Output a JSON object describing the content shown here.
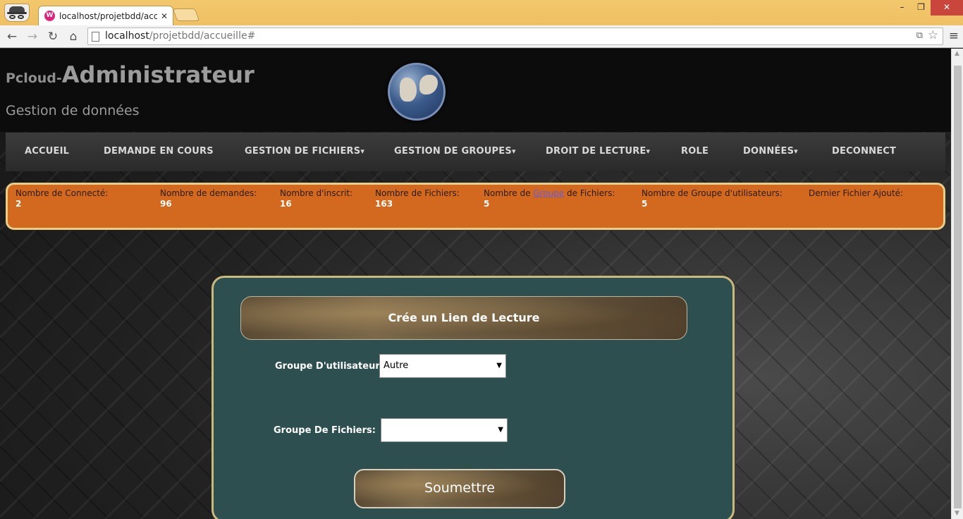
{
  "browser": {
    "tab_title": "localhost/projetbdd/accu",
    "favicon_text": "W",
    "url_host": "localhost",
    "url_path": "/projetbdd/accueille#",
    "window_controls": {
      "minimize": "–",
      "maximize": "❐",
      "close": "✕"
    }
  },
  "header": {
    "brand_small": "Pcloud-",
    "brand_big": "Administrateur",
    "subtitle": "Gestion de données"
  },
  "nav": {
    "items": [
      {
        "label": "ACCUEIL",
        "dropdown": false
      },
      {
        "label": "DEMANDE EN COURS",
        "dropdown": false
      },
      {
        "label": "GESTION DE FICHIERS",
        "dropdown": true
      },
      {
        "label": "GESTION DE GROUPES",
        "dropdown": true
      },
      {
        "label": "DROIT DE LECTURE",
        "dropdown": true
      },
      {
        "label": "ROLE",
        "dropdown": false
      },
      {
        "label": "DONNÉES",
        "dropdown": true
      },
      {
        "label": "DECONNECT",
        "dropdown": false
      }
    ],
    "caret": "▾"
  },
  "stats": {
    "connected_label": "Nombre de Connecté:",
    "connected_value": "2",
    "requests_label": "Nombre de demandes:",
    "requests_value": "96",
    "registered_label": "Nombre d'inscrit:",
    "registered_value": "16",
    "files_label": "Nombre de Fichiers:",
    "files_value": "163",
    "file_groups_label_pre": "Nombre de ",
    "file_groups_label_link": "Groupe",
    "file_groups_label_post": " de Fichiers:",
    "file_groups_value": "5",
    "user_groups_label": "Nombre de Groupe d'utilisateurs:",
    "user_groups_value": "5",
    "last_file_label": "Dernier Fichier Ajouté:",
    "last_file_value": ""
  },
  "form": {
    "title": "Crée un Lien de Lecture",
    "user_group_label": "Groupe D'utilisateurs:",
    "user_group_value": "Autre",
    "file_group_label": "Groupe De Fichiers:",
    "file_group_value": "",
    "submit_label": "Soumettre"
  },
  "colors": {
    "stats_bg": "#d2691e",
    "stats_border": "#e8cf89",
    "panel_bg": "#2e4f4f",
    "panel_border": "#c9b97a",
    "titlebar": "#f3c76c"
  },
  "icons": {
    "back": "←",
    "forward": "→",
    "reload": "↻",
    "home": "⌂",
    "star": "☆",
    "menu": "≡",
    "translate": "⧉",
    "select_arrow": "▼",
    "scroll_up": "▲",
    "scroll_down": "▼"
  }
}
